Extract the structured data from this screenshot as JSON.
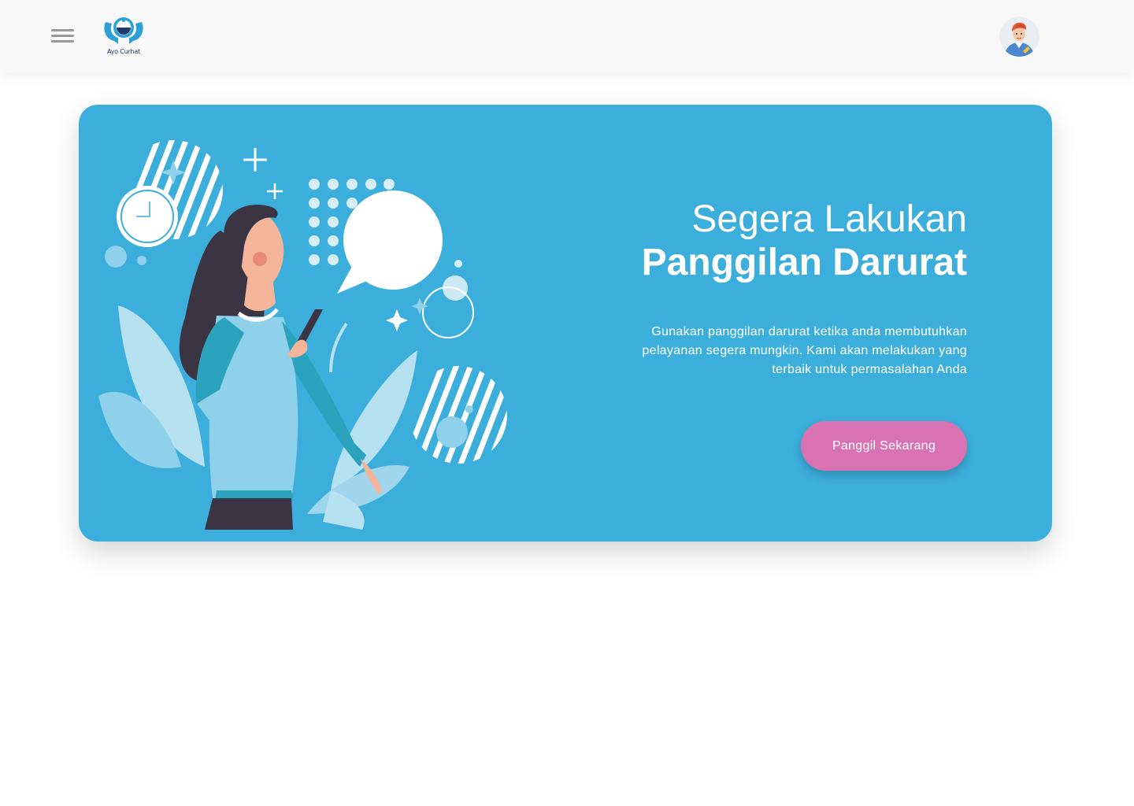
{
  "header": {
    "menu_icon": "hamburger-menu-icon",
    "logo_text": "Ayo Curhat",
    "avatar_icon": "user-avatar"
  },
  "hero": {
    "title_line1": "Segera Lakukan",
    "title_line2": "Panggilan Darurat",
    "description": "Gunakan panggilan darurat ketika anda membutuhkan pelayanan segera mungkin. Kami akan melakukan yang terbaik untuk permasalahan Anda",
    "button_label": "Panggil Sekarang",
    "illustration": "woman-with-phone-illustration"
  },
  "colors": {
    "header_bg": "#f8f8f8",
    "card_bg": "#3caedb",
    "button_bg": "#d872b2",
    "text_on_card": "#ffffff"
  }
}
